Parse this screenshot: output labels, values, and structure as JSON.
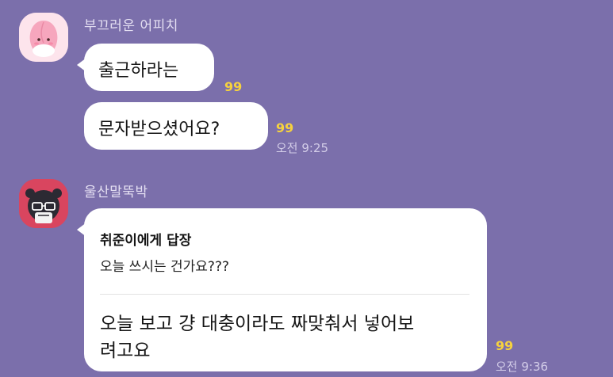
{
  "messages_group_1": {
    "sender": "부끄러운 어피치",
    "avatar_icon": "peach-character-icon",
    "bubbles": [
      {
        "text": "출근하라는",
        "unread": "99"
      },
      {
        "text": "문자받으셨어요?",
        "unread": "99",
        "time": "오전 9:25"
      }
    ]
  },
  "messages_group_2": {
    "sender": "울산말뚝박",
    "avatar_icon": "bear-character-icon",
    "reply": {
      "header": "취준이에게 답장",
      "quote": "오늘 쓰시는 건가요???",
      "body_line1": "오늘 보고 걍 대충이라도 짜맞춰서 넣어보",
      "body_line2": "려고요",
      "unread": "99",
      "time": "오전 9:36"
    }
  },
  "colors": {
    "background": "#7b6fab",
    "bubble": "#ffffff",
    "unread": "#f6d23e",
    "sender_text": "#e4dff2"
  }
}
